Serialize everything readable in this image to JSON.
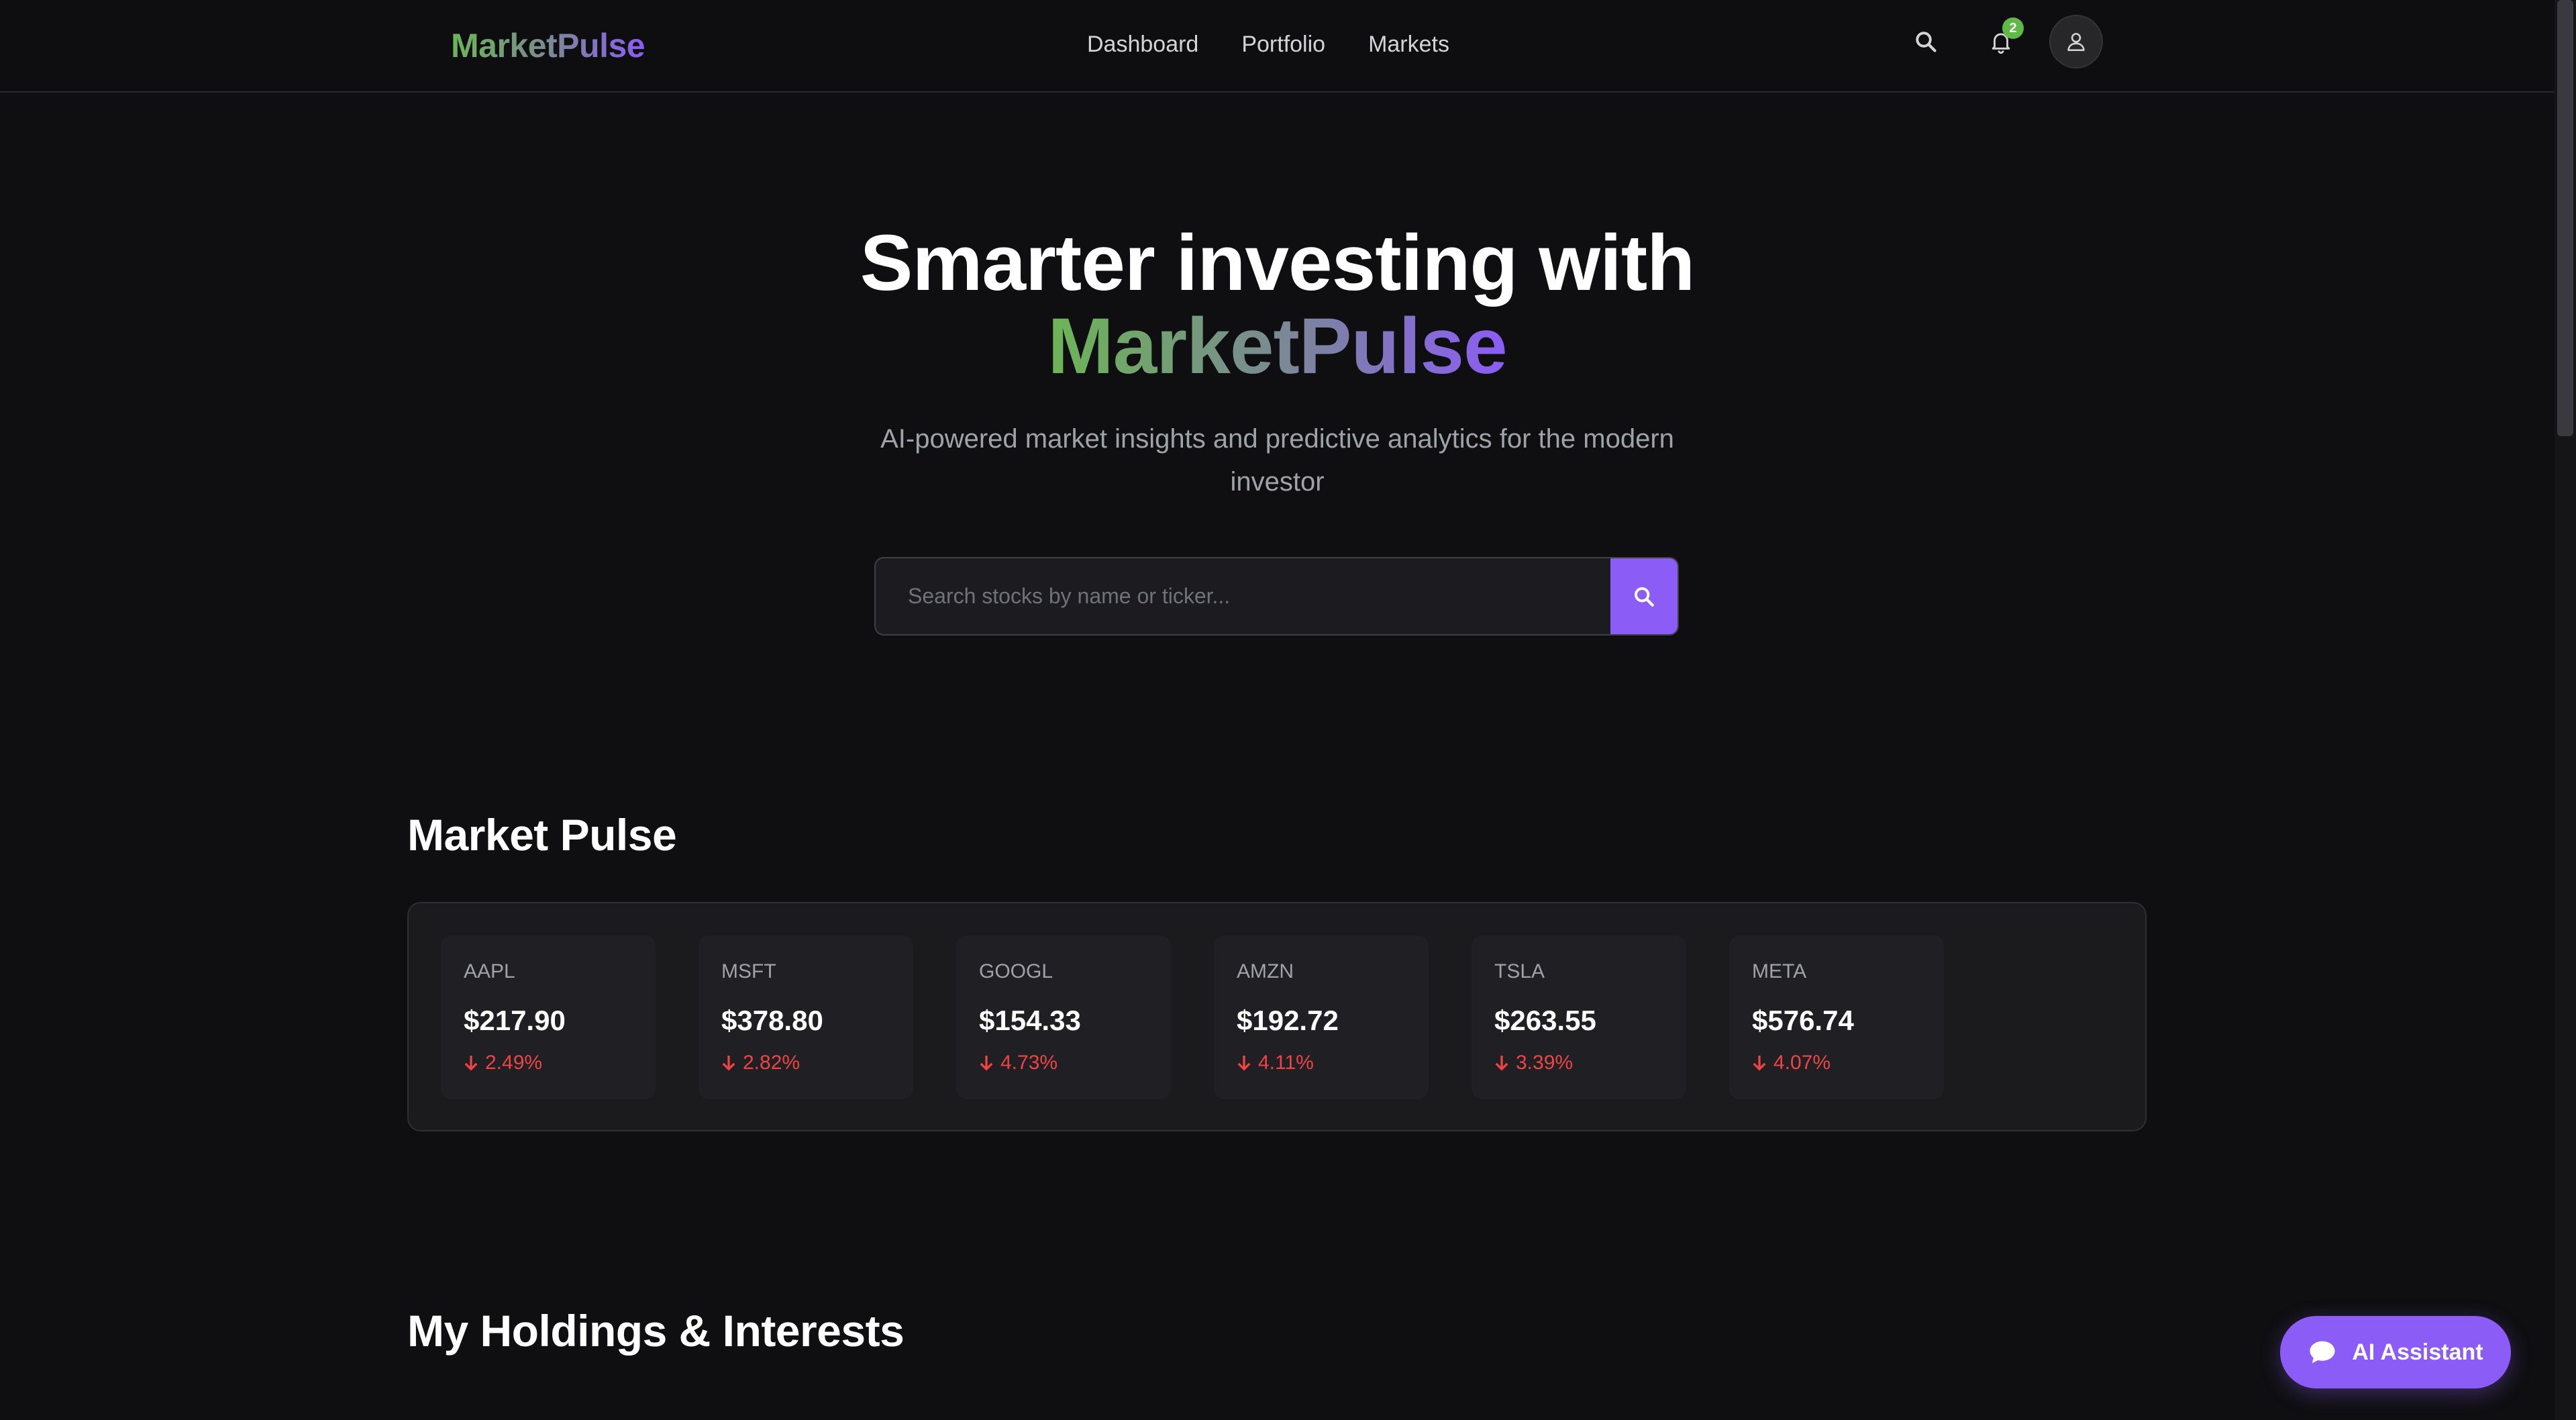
{
  "app": {
    "name": "MarketPulse"
  },
  "nav": {
    "links": [
      {
        "label": "Dashboard"
      },
      {
        "label": "Portfolio"
      },
      {
        "label": "Markets"
      }
    ],
    "notification_count": "2",
    "icons": [
      "search-icon",
      "bell-icon",
      "user-icon"
    ]
  },
  "hero": {
    "title_line1": "Smarter investing with",
    "title_line2": "MarketPulse",
    "subtitle": "AI-powered market insights and predictive analytics for the modern investor"
  },
  "search": {
    "placeholder": "Search stocks by name or ticker...",
    "value": ""
  },
  "market_pulse": {
    "title": "Market Pulse",
    "tickers": [
      {
        "symbol": "AAPL",
        "price": "$217.90",
        "change": "2.49%",
        "direction": "down"
      },
      {
        "symbol": "MSFT",
        "price": "$378.80",
        "change": "2.82%",
        "direction": "down"
      },
      {
        "symbol": "GOOGL",
        "price": "$154.33",
        "change": "4.73%",
        "direction": "down"
      },
      {
        "symbol": "AMZN",
        "price": "$192.72",
        "change": "4.11%",
        "direction": "down"
      },
      {
        "symbol": "TSLA",
        "price": "$263.55",
        "change": "3.39%",
        "direction": "down"
      },
      {
        "symbol": "META",
        "price": "$576.74",
        "change": "4.07%",
        "direction": "down"
      }
    ]
  },
  "holdings": {
    "title": "My Holdings & Interests"
  },
  "ai_assistant": {
    "label": "AI Assistant"
  },
  "colors": {
    "background": "#0f0f11",
    "accent": "#8b5cf6",
    "brand_green": "#6cb556",
    "negative": "#ef4444",
    "badge": "#5fb848"
  }
}
